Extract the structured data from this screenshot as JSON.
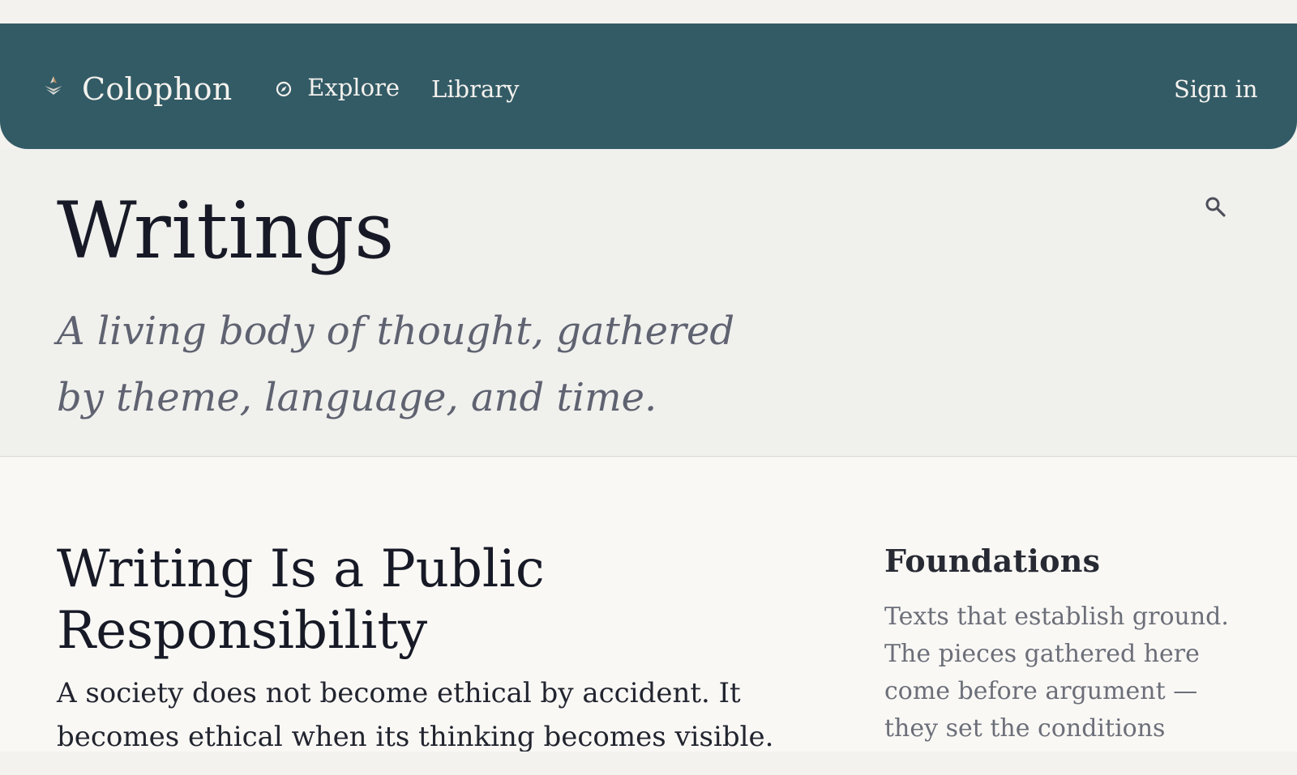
{
  "nav": {
    "brand": "Colophon",
    "explore_label": "Explore",
    "library_label": "Library",
    "signin_label": "Sign in"
  },
  "hero": {
    "title": "Writings",
    "subtitle": "A living body of thought, gathered by theme, language, and time."
  },
  "article": {
    "title": "Writing Is a Public Responsibility",
    "excerpt": "A society does not become ethical by accident. It becomes ethical when its thinking becomes visible."
  },
  "section": {
    "title": "Foundations",
    "text": "Texts that establish ground. The pieces gathered here come before argument — they set the conditions"
  },
  "icons": {
    "brand": "book-stack-icon",
    "explore": "compass-icon",
    "search": "search-icon"
  },
  "colors": {
    "nav_background": "#335b66",
    "nav_text": "#f4f2ee",
    "hero_background": "#f0f0ed",
    "content_background": "#f9f8f5",
    "title_text": "#171a26",
    "muted_text": "#5f6270"
  }
}
